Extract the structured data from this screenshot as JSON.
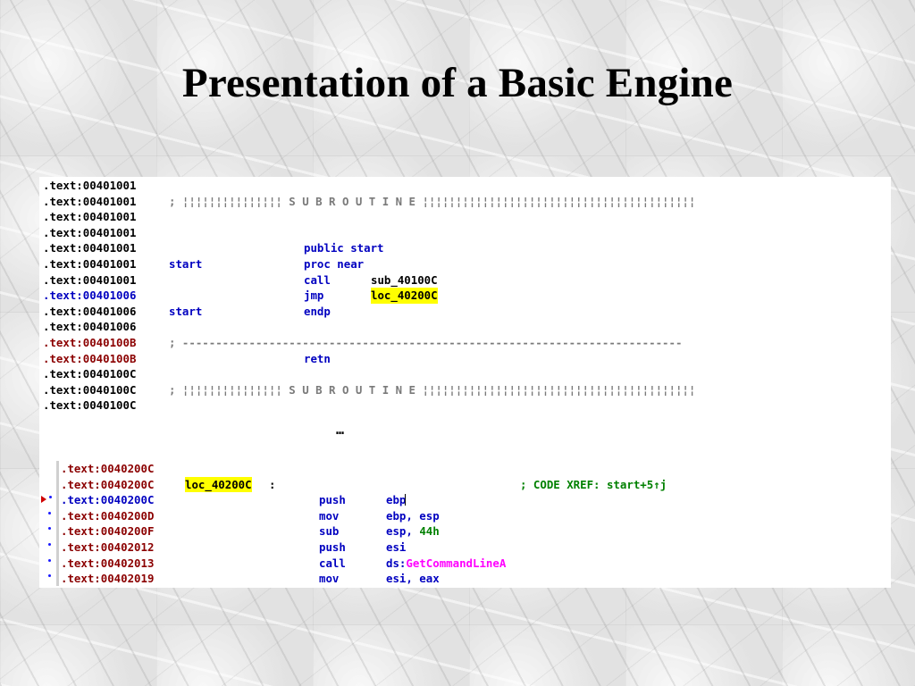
{
  "slide": {
    "title": "Presentation of a Basic Engine"
  },
  "colors": {
    "black": "#000000",
    "blue": "#0000c0",
    "dark_red": "#8b0000",
    "gray": "#7a7a7a",
    "green": "#008000",
    "magenta": "#ff00ff",
    "highlight": "#ffff00"
  },
  "panel1": {
    "lines": [
      {
        "addr": ".text:00401001",
        "addr_color": "black"
      },
      {
        "addr": ".text:00401001",
        "addr_color": "black",
        "comment": "; ¦¦¦¦¦¦¦¦¦¦¦¦¦¦¦ S U B R O U T I N E ¦¦¦¦¦¦¦¦¦¦¦¦¦¦¦¦¦¦¦¦¦¦¦¦¦¦¦¦¦¦¦¦¦¦¦¦¦¦¦¦¦"
      },
      {
        "addr": ".text:00401001",
        "addr_color": "black"
      },
      {
        "addr": ".text:00401001",
        "addr_color": "black"
      },
      {
        "addr": ".text:00401001",
        "addr_color": "black",
        "mnem": "public start"
      },
      {
        "addr": ".text:00401001",
        "addr_color": "black",
        "label": "start",
        "mnem": "proc near"
      },
      {
        "addr": ".text:00401001",
        "addr_color": "black",
        "mnem": "call",
        "op": "sub_40100C"
      },
      {
        "addr": ".text:00401006",
        "addr_color": "blue",
        "mnem": "jmp",
        "op": "loc_40200C",
        "op_highlight": true
      },
      {
        "addr": ".text:00401006",
        "addr_color": "black",
        "label": "start",
        "mnem": "endp"
      },
      {
        "addr": ".text:00401006",
        "addr_color": "black"
      },
      {
        "addr": ".text:0040100B",
        "addr_color": "dark_red",
        "comment": "; ---------------------------------------------------------------------------"
      },
      {
        "addr": ".text:0040100B",
        "addr_color": "dark_red",
        "mnem": "retn"
      },
      {
        "addr": ".text:0040100C",
        "addr_color": "black"
      },
      {
        "addr": ".text:0040100C",
        "addr_color": "black",
        "comment": "; ¦¦¦¦¦¦¦¦¦¦¦¦¦¦¦ S U B R O U T I N E ¦¦¦¦¦¦¦¦¦¦¦¦¦¦¦¦¦¦¦¦¦¦¦¦¦¦¦¦¦¦¦¦¦¦¦¦¦¦¦¦¦"
      },
      {
        "addr": ".text:0040100C",
        "addr_color": "black"
      }
    ]
  },
  "panel2": {
    "ellipsis": "…",
    "lines": [
      {
        "addr": ".text:0040200C",
        "addr_color": "dark_red"
      },
      {
        "addr": ".text:0040200C",
        "addr_color": "dark_red",
        "label": "loc_40200C",
        "label_suffix": ":",
        "xref": "; CODE XREF: start+5↑j"
      },
      {
        "addr": ".text:0040200C",
        "addr_color": "blue",
        "mnem": "push",
        "op": "ebp",
        "marker": "arrow"
      },
      {
        "addr": ".text:0040200D",
        "addr_color": "dark_red",
        "mnem": "mov",
        "op": "ebp, esp",
        "marker": "dot"
      },
      {
        "addr": ".text:0040200F",
        "addr_color": "dark_red",
        "mnem": "sub",
        "op": "esp, ",
        "op_extra": "44h",
        "marker": "dot"
      },
      {
        "addr": ".text:00402012",
        "addr_color": "dark_red",
        "mnem": "push",
        "op": "esi",
        "marker": "dot"
      },
      {
        "addr": ".text:00402013",
        "addr_color": "dark_red",
        "mnem": "call",
        "op": "ds:",
        "op_extra": "GetCommandLineA",
        "marker": "dot"
      },
      {
        "addr": ".text:00402019",
        "addr_color": "dark_red",
        "mnem": "mov",
        "op": "esi, eax",
        "marker": "dot"
      }
    ]
  }
}
